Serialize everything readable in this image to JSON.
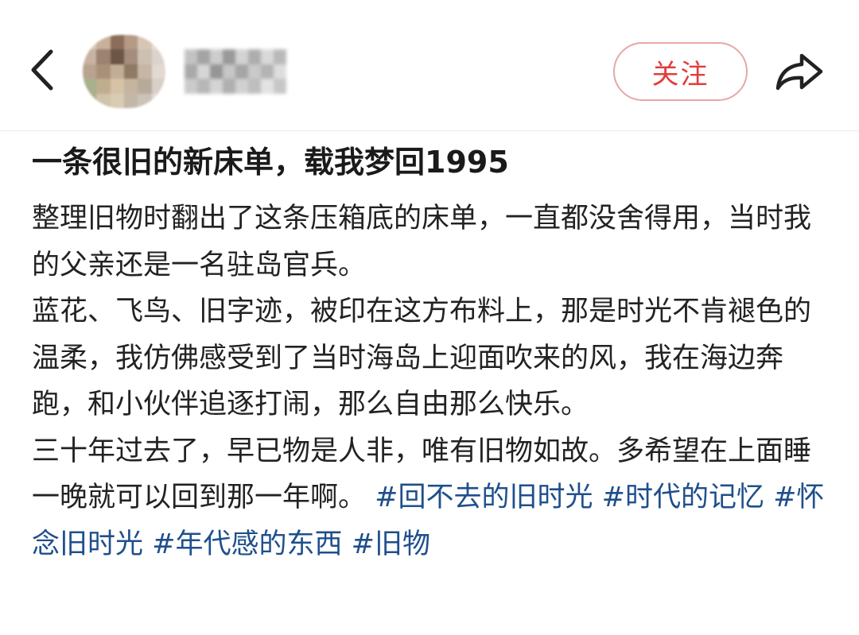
{
  "header": {
    "back_icon": "chevron-left-icon",
    "follow_label": "关注",
    "share_icon": "share-arrow-icon"
  },
  "post": {
    "title": "一条很旧的新床单，载我梦回1995",
    "paragraphs": [
      "整理旧物时翻出了这条压箱底的床单，一直都没舍得用，当时我的父亲还是一名驻岛官兵。",
      "蓝花、飞鸟、旧字迹，被印在这方布料上，那是时光不肯褪色的温柔，我仿佛感受到了当时海岛上迎面吹来的风，我在海边奔跑，和小伙伴追逐打闹，那么自由那么快乐。",
      "三十年过去了，早已物是人非，唯有旧物如故。多希望在上面睡一晚就可以回到那一年啊。"
    ],
    "tags": [
      "#回不去的旧时光",
      "#时代的记忆",
      "#怀念旧时光",
      "#年代感的东西",
      "#旧物"
    ]
  },
  "colors": {
    "follow": "#e23d3d",
    "follow_border": "#e6a7a7",
    "tag": "#1f4f8c",
    "text": "#222222"
  }
}
